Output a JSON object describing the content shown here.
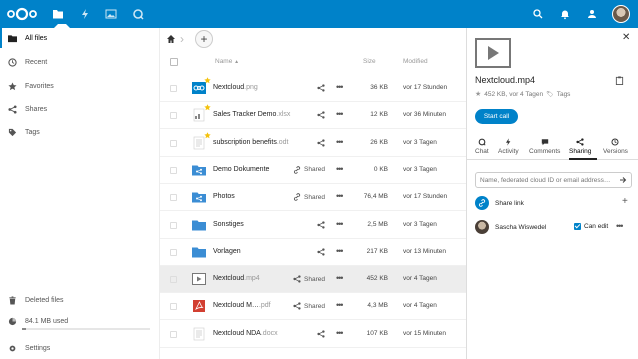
{
  "colors": {
    "brand": "#0082c9",
    "folder": "#3b8dd4",
    "star": "#f4c20d",
    "pdf": "#d23f31"
  },
  "header": {
    "apps": [
      "files-icon",
      "activity-icon",
      "gallery-icon",
      "talk-icon"
    ],
    "right_icons": [
      "search-icon",
      "notifications-icon",
      "contacts-icon"
    ]
  },
  "nav": {
    "items": [
      {
        "label": "All files",
        "icon": "folder-icon"
      },
      {
        "label": "Recent",
        "icon": "clock-icon"
      },
      {
        "label": "Favorites",
        "icon": "star-icon"
      },
      {
        "label": "Shares",
        "icon": "share-icon"
      },
      {
        "label": "Tags",
        "icon": "tag-icon"
      }
    ],
    "deleted": "Deleted files",
    "quota": "84.1 MB used",
    "quota_fraction": 0.03,
    "settings": "Settings"
  },
  "list": {
    "col_name": "Name",
    "col_size": "Size",
    "col_modified": "Modified",
    "sort_arrow": "▲",
    "rows": [
      {
        "name": "Nextcloud",
        "ext": ".png",
        "share": "",
        "size": "36 KB",
        "modified": "vor 17 Stunden",
        "type": "image",
        "star": true
      },
      {
        "name": "Sales Tracker Demo",
        "ext": ".xlsx",
        "share": "",
        "size": "12 KB",
        "modified": "vor 36 Minuten",
        "type": "sheet",
        "star": true
      },
      {
        "name": "subscription benefits",
        "ext": ".odt",
        "share": "",
        "size": "26 KB",
        "modified": "vor 3 Tagen",
        "type": "doc",
        "star": true
      },
      {
        "name": "Demo Dokumente",
        "ext": "",
        "share": "Shared",
        "size": "0 KB",
        "modified": "vor 3 Tagen",
        "type": "folder-shared",
        "star": false
      },
      {
        "name": "Photos",
        "ext": "",
        "share": "Shared",
        "size": "76,4 MB",
        "modified": "vor 17 Stunden",
        "type": "folder-shared",
        "star": false
      },
      {
        "name": "Sonstiges",
        "ext": "",
        "share": "",
        "size": "2,5 MB",
        "modified": "vor 3 Tagen",
        "type": "folder",
        "star": false
      },
      {
        "name": "Vorlagen",
        "ext": "",
        "share": "",
        "size": "217 KB",
        "modified": "vor 13 Minuten",
        "type": "folder",
        "star": false
      },
      {
        "name": "Nextcloud",
        "ext": ".mp4",
        "share": "Shared",
        "size": "452 KB",
        "modified": "vor 4 Tagen",
        "type": "video",
        "star": false
      },
      {
        "name": "Nextcloud M…",
        "ext": ".pdf",
        "share": "Shared",
        "size": "4,3 MB",
        "modified": "vor 4 Tagen",
        "type": "pdf",
        "star": false
      },
      {
        "name": "Nextcloud NDA",
        "ext": ".docx",
        "share": "",
        "size": "107 KB",
        "modified": "vor 15 Minuten",
        "type": "doc",
        "star": false
      }
    ]
  },
  "sidebar": {
    "title": "Nextcloud.mp4",
    "meta": "452 KB, vor 4 Tagen",
    "tags": "Tags",
    "start_call": "Start call",
    "tabs": [
      {
        "label": "Chat",
        "icon": "chat-icon"
      },
      {
        "label": "Activity",
        "icon": "activity-icon"
      },
      {
        "label": "Comments",
        "icon": "comments-icon"
      },
      {
        "label": "Sharing",
        "icon": "share-icon"
      },
      {
        "label": "Versions",
        "icon": "history-icon"
      }
    ],
    "share_placeholder": "Name, federated cloud ID or email address…",
    "share_link": "Share link",
    "user_name": "Sascha Wiswedel",
    "can_edit": "Can edit"
  }
}
